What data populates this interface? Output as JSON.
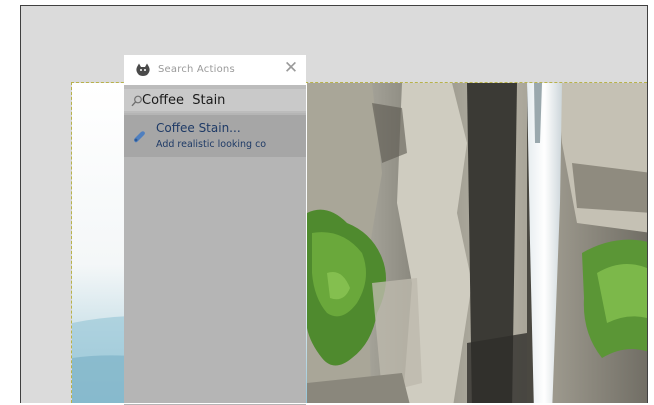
{
  "dialog": {
    "title": "Search Actions",
    "close_symbol": "✕",
    "title_icon": "wilber-icon"
  },
  "search": {
    "value": "Coffee  Stain",
    "icon": "magnifier-icon"
  },
  "results": [
    {
      "name": "Coffee Stain...",
      "description": "Add realistic looking co",
      "icon": "filter-icon"
    }
  ],
  "colors": {
    "canvas_bg": "#dbdbdb",
    "dialog_bg": "#bcbcbc",
    "selected_item": "#a6a6a6",
    "result_text": "#1e3a66",
    "layer_boundary": "#b8b24a"
  }
}
